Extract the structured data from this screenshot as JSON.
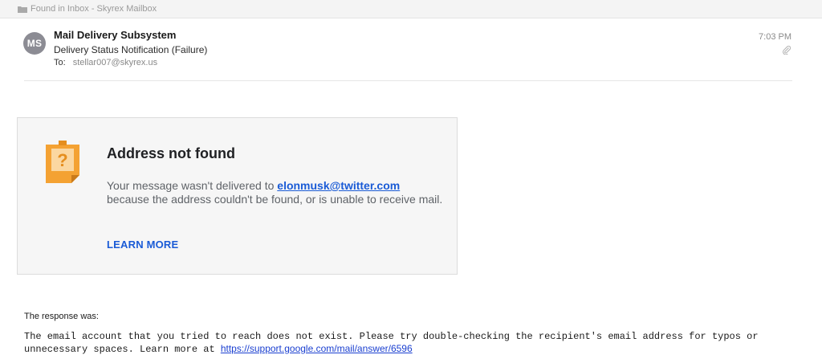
{
  "header": {
    "location_label": "Found in Inbox - Skyrex Mailbox"
  },
  "message": {
    "avatar_initials": "MS",
    "sender": "Mail Delivery Subsystem",
    "subject": "Delivery Status Notification (Failure)",
    "to_label": "To:",
    "to_address": "stellar007@skyrex.us",
    "time": "7:03 PM"
  },
  "card": {
    "title": "Address not found",
    "body_prefix": "Your message wasn't delivered to ",
    "recipient": "elonmusk@twitter.com",
    "body_suffix": " because the address couldn't be found, or is unable to receive mail.",
    "learn_more": "LEARN MORE"
  },
  "response": {
    "label": "The response was:",
    "text": "The email account that you tried to reach does not exist. Please try double-checking the recipient's email address for typos or unnecessary spaces. Learn more at ",
    "link": "https://support.google.com/mail/answer/6596"
  },
  "colors": {
    "accent_link": "#1a5bd6",
    "icon_orange": "#f4a233",
    "avatar_gray": "#8c8c94"
  }
}
